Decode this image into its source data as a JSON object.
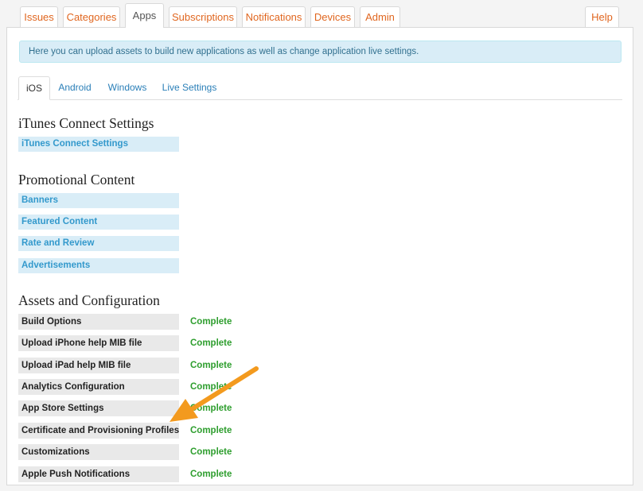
{
  "top_tabs": [
    {
      "label": "Issues"
    },
    {
      "label": "Categories"
    },
    {
      "label": "Apps"
    },
    {
      "label": "Subscriptions"
    },
    {
      "label": "Notifications"
    },
    {
      "label": "Devices"
    },
    {
      "label": "Admin"
    }
  ],
  "help_label": "Help",
  "info_message": "Here you can upload assets to build new applications as well as change application live settings.",
  "platform_tabs": [
    {
      "label": "iOS"
    },
    {
      "label": "Android"
    },
    {
      "label": "Windows"
    },
    {
      "label": "Live Settings"
    }
  ],
  "itunes": {
    "title": "iTunes Connect Settings",
    "items": [
      {
        "label": "iTunes Connect Settings"
      }
    ]
  },
  "promo": {
    "title": "Promotional Content",
    "items": [
      {
        "label": "Banners"
      },
      {
        "label": "Featured Content"
      },
      {
        "label": "Rate and Review"
      },
      {
        "label": "Advertisements"
      }
    ]
  },
  "assets": {
    "title": "Assets and Configuration",
    "rows": [
      {
        "label": "Build Options",
        "status": "Complete"
      },
      {
        "label": "Upload iPhone help MIB file",
        "status": "Complete"
      },
      {
        "label": "Upload iPad help MIB file",
        "status": "Complete"
      },
      {
        "label": "Analytics Configuration",
        "status": "Complete"
      },
      {
        "label": "App Store Settings",
        "status": "Complete"
      },
      {
        "label": "Certificate and Provisioning Profiles",
        "status": "Complete"
      },
      {
        "label": "Customizations",
        "status": "Complete"
      },
      {
        "label": "Apple Push Notifications",
        "status": "Complete"
      }
    ]
  },
  "colors": {
    "tab_link": "#e0661f",
    "sub_tab_link": "#2a7fb8",
    "info_bg": "#d9edf7",
    "status_complete": "#2e9e2e",
    "annotation_arrow": "#f39a1e"
  }
}
